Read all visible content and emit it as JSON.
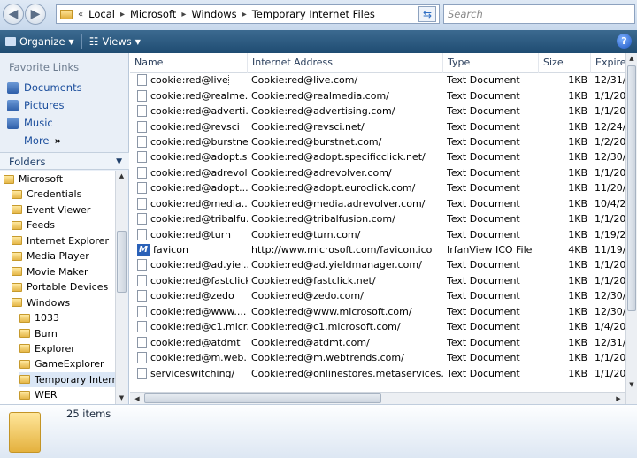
{
  "address": {
    "overflow": "«",
    "segments": [
      "Local",
      "Microsoft",
      "Windows",
      "Temporary Internet Files"
    ]
  },
  "search": {
    "placeholder": "Search"
  },
  "toolbar": {
    "organize": "Organize",
    "views": "Views",
    "help": "?"
  },
  "nav": {
    "favorite_title": "Favorite Links",
    "favorites": [
      "Documents",
      "Pictures",
      "Music"
    ],
    "more": "More",
    "more_glyph": "»",
    "folders_title": "Folders",
    "tree": [
      {
        "label": "Microsoft",
        "level": 0
      },
      {
        "label": "Credentials",
        "level": 1
      },
      {
        "label": "Event Viewer",
        "level": 1
      },
      {
        "label": "Feeds",
        "level": 1
      },
      {
        "label": "Internet Explorer",
        "level": 1
      },
      {
        "label": "Media Player",
        "level": 1
      },
      {
        "label": "Movie Maker",
        "level": 1
      },
      {
        "label": "Portable Devices",
        "level": 1
      },
      {
        "label": "Windows",
        "level": 1
      },
      {
        "label": "1033",
        "level": 2
      },
      {
        "label": "Burn",
        "level": 2
      },
      {
        "label": "Explorer",
        "level": 2
      },
      {
        "label": "GameExplorer",
        "level": 2
      },
      {
        "label": "Temporary Interne",
        "level": 2,
        "selected": true
      },
      {
        "label": "WER",
        "level": 2
      }
    ]
  },
  "columns": [
    "Name",
    "Internet Address",
    "Type",
    "Size",
    "Expires"
  ],
  "files": [
    {
      "name": "cookie:red@live",
      "addr": "Cookie:red@live.com/",
      "type": "Text Document",
      "size": "1KB",
      "exp": "12/31/"
    },
    {
      "name": "cookie:red@realme...",
      "addr": "Cookie:red@realmedia.com/",
      "type": "Text Document",
      "size": "1KB",
      "exp": "1/1/20"
    },
    {
      "name": "cookie:red@adverti...",
      "addr": "Cookie:red@advertising.com/",
      "type": "Text Document",
      "size": "1KB",
      "exp": "1/1/20"
    },
    {
      "name": "cookie:red@revsci",
      "addr": "Cookie:red@revsci.net/",
      "type": "Text Document",
      "size": "1KB",
      "exp": "12/24/"
    },
    {
      "name": "cookie:red@burstnet",
      "addr": "Cookie:red@burstnet.com/",
      "type": "Text Document",
      "size": "1KB",
      "exp": "1/2/20"
    },
    {
      "name": "cookie:red@adopt.s...",
      "addr": "Cookie:red@adopt.specificclick.net/",
      "type": "Text Document",
      "size": "1KB",
      "exp": "12/30/"
    },
    {
      "name": "cookie:red@adrevol...",
      "addr": "Cookie:red@adrevolver.com/",
      "type": "Text Document",
      "size": "1KB",
      "exp": "1/1/20"
    },
    {
      "name": "cookie:red@adopt....",
      "addr": "Cookie:red@adopt.euroclick.com/",
      "type": "Text Document",
      "size": "1KB",
      "exp": "11/20/"
    },
    {
      "name": "cookie:red@media....",
      "addr": "Cookie:red@media.adrevolver.com/",
      "type": "Text Document",
      "size": "1KB",
      "exp": "10/4/2"
    },
    {
      "name": "cookie:red@tribalfu...",
      "addr": "Cookie:red@tribalfusion.com/",
      "type": "Text Document",
      "size": "1KB",
      "exp": "1/1/20"
    },
    {
      "name": "cookie:red@turn",
      "addr": "Cookie:red@turn.com/",
      "type": "Text Document",
      "size": "1KB",
      "exp": "1/19/2"
    },
    {
      "name": "favicon",
      "addr": "http://www.microsoft.com/favicon.ico",
      "type": "IrfanView ICO File",
      "size": "4KB",
      "exp": "11/19/",
      "icon": "irfanview-icon"
    },
    {
      "name": "cookie:red@ad.yiel...",
      "addr": "Cookie:red@ad.yieldmanager.com/",
      "type": "Text Document",
      "size": "1KB",
      "exp": "1/1/20"
    },
    {
      "name": "cookie:red@fastclick",
      "addr": "Cookie:red@fastclick.net/",
      "type": "Text Document",
      "size": "1KB",
      "exp": "1/1/20"
    },
    {
      "name": "cookie:red@zedo",
      "addr": "Cookie:red@zedo.com/",
      "type": "Text Document",
      "size": "1KB",
      "exp": "12/30/"
    },
    {
      "name": "cookie:red@www....",
      "addr": "Cookie:red@www.microsoft.com/",
      "type": "Text Document",
      "size": "1KB",
      "exp": "12/30/"
    },
    {
      "name": "cookie:red@c1.micr...",
      "addr": "Cookie:red@c1.microsoft.com/",
      "type": "Text Document",
      "size": "1KB",
      "exp": "1/4/20"
    },
    {
      "name": "cookie:red@atdmt",
      "addr": "Cookie:red@atdmt.com/",
      "type": "Text Document",
      "size": "1KB",
      "exp": "12/31/"
    },
    {
      "name": "cookie:red@m.web...",
      "addr": "Cookie:red@m.webtrends.com/",
      "type": "Text Document",
      "size": "1KB",
      "exp": "1/1/20"
    },
    {
      "name": "serviceswitching/",
      "addr": "Cookie:red@onlinestores.metaservices.m...",
      "type": "Text Document",
      "size": "1KB",
      "exp": "1/1/20"
    }
  ],
  "status": {
    "count": "25 items"
  }
}
